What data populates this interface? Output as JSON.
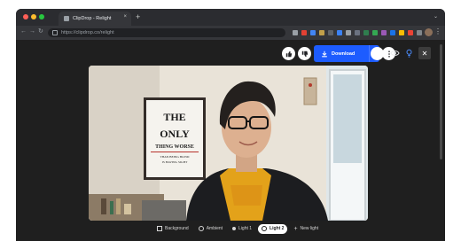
{
  "browser": {
    "tab_title": "ClipDrop - Relight",
    "close_glyph": "×",
    "new_tab_glyph": "+",
    "tabstrip_caret": "⌄",
    "back_glyph": "←",
    "forward_glyph": "→",
    "reload_glyph": "↻",
    "url": "https://clipdrop.co/relight",
    "menu_glyph": "⋮"
  },
  "app": {
    "download_label": "Download",
    "close_glyph": "✕",
    "download_caret": "⌄",
    "accent": "#1d5cff"
  },
  "controls": [
    {
      "label": "Background",
      "icon": "background-icon",
      "active": false
    },
    {
      "label": "Ambient",
      "icon": "ambient-icon",
      "active": false
    },
    {
      "label": "Light 1",
      "icon": "light-bulb-icon",
      "active": false
    },
    {
      "label": "Light 2",
      "icon": "light-bulb-icon",
      "active": true
    },
    {
      "label": "New light",
      "icon": "plus-icon",
      "active": false
    }
  ],
  "photo": {
    "poster_lines": [
      "THE",
      "ONLY",
      "THING WORSE",
      "THAN BEING BLIND",
      "IS HAVING SIGHT"
    ]
  }
}
